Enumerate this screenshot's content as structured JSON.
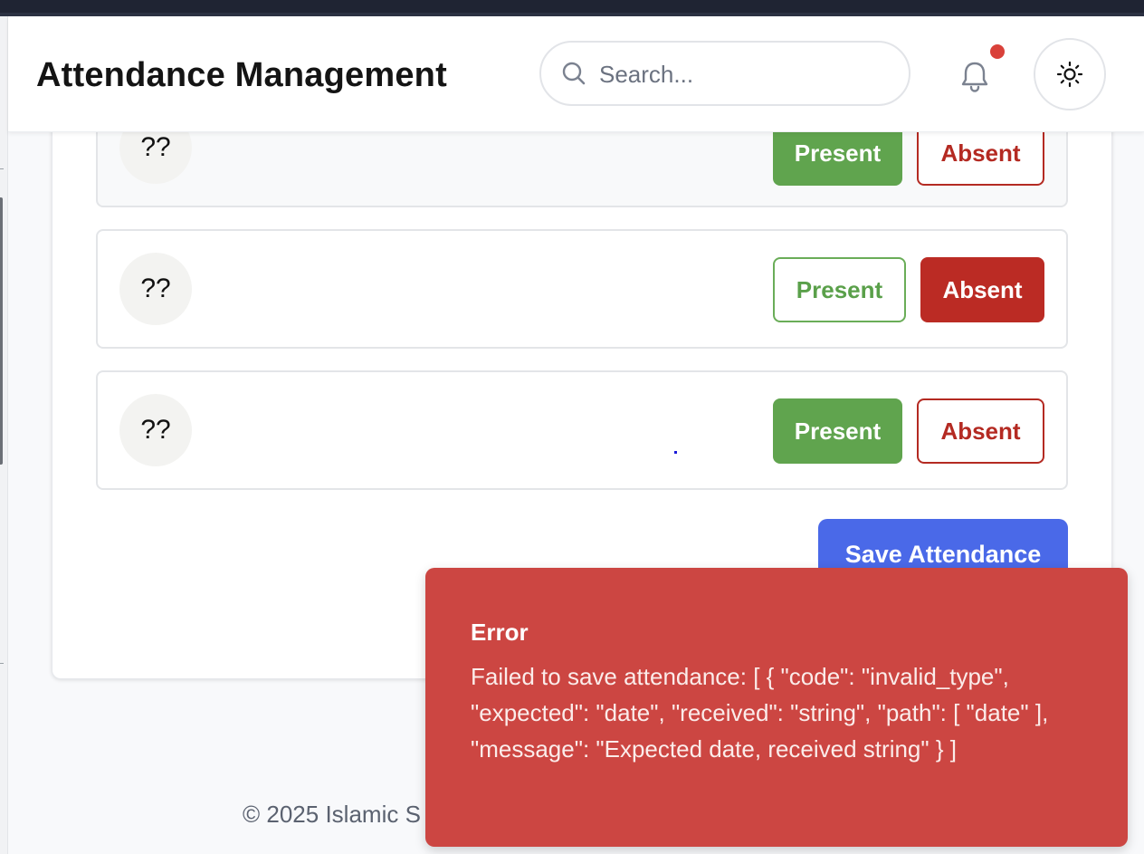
{
  "header": {
    "title": "Attendance Management",
    "search_placeholder": "Search...",
    "notification_indicator_color": "#d9413a"
  },
  "students": [
    {
      "avatar_initials": "??",
      "present_label": "Present",
      "absent_label": "Absent",
      "status": "present"
    },
    {
      "avatar_initials": "??",
      "present_label": "Present",
      "absent_label": "Absent",
      "status": "absent"
    },
    {
      "avatar_initials": "??",
      "present_label": "Present",
      "absent_label": "Absent",
      "status": "present"
    }
  ],
  "actions": {
    "save_label": "Save Attendance"
  },
  "footer": {
    "copyright": "© 2025 Islamic S"
  },
  "toast": {
    "title": "Error",
    "message": "Failed to save attendance: [ { \"code\": \"invalid_type\", \"expected\": \"date\", \"received\": \"string\", \"path\": [ \"date\" ], \"message\": \"Expected date, received string\" } ]"
  },
  "colors": {
    "present": "#60a44e",
    "absent": "#bb2b24",
    "primary": "#4a69e8",
    "error": "#cc4642"
  },
  "icons": [
    "search-icon",
    "bell-icon",
    "sun-icon"
  ]
}
